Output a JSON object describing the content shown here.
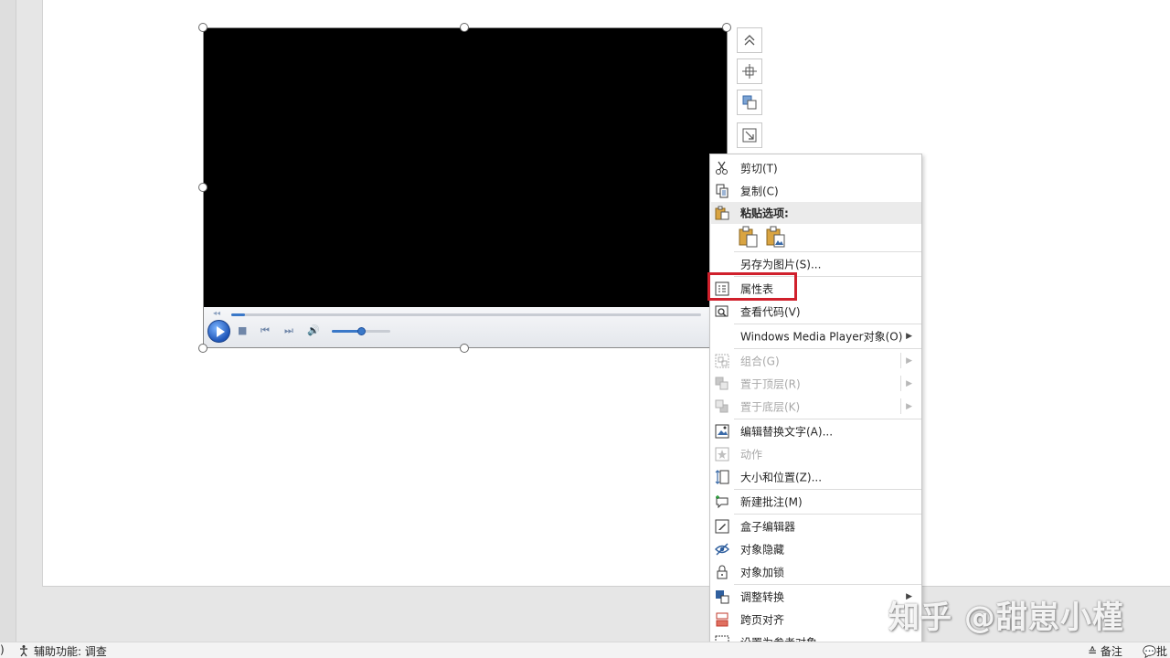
{
  "context_menu": {
    "cut": "剪切(T)",
    "copy": "复制(C)",
    "paste_options": "粘贴选项:",
    "save_as_picture": "另存为图片(S)...",
    "property_sheet": "属性表",
    "view_code": "查看代码(V)",
    "wmp_object": "Windows Media Player对象(O)",
    "group": "组合(G)",
    "bring_to_front": "置于顶层(R)",
    "send_to_back": "置于底层(K)",
    "edit_alt_text": "编辑替换文字(A)...",
    "action": "动作",
    "size_position": "大小和位置(Z)...",
    "new_comment": "新建批注(M)",
    "box_editor": "盒子编辑器",
    "hide_object": "对象隐藏",
    "lock_object": "对象加锁",
    "adjust_convert": "调整转换",
    "cross_page_align": "跨页对齐",
    "set_reference": "设置为参考对象"
  },
  "media_player": {
    "seek_progress": 0.03,
    "volume_level": 0.5
  },
  "status_bar": {
    "left_fragment": ")",
    "accessibility": "辅助功能: 调查",
    "notes": "备注",
    "comments": "批"
  },
  "watermark": "知乎 @甜崽小槿",
  "colors": {
    "highlight": "#d0202c",
    "accent_blue": "#3a78c8"
  }
}
